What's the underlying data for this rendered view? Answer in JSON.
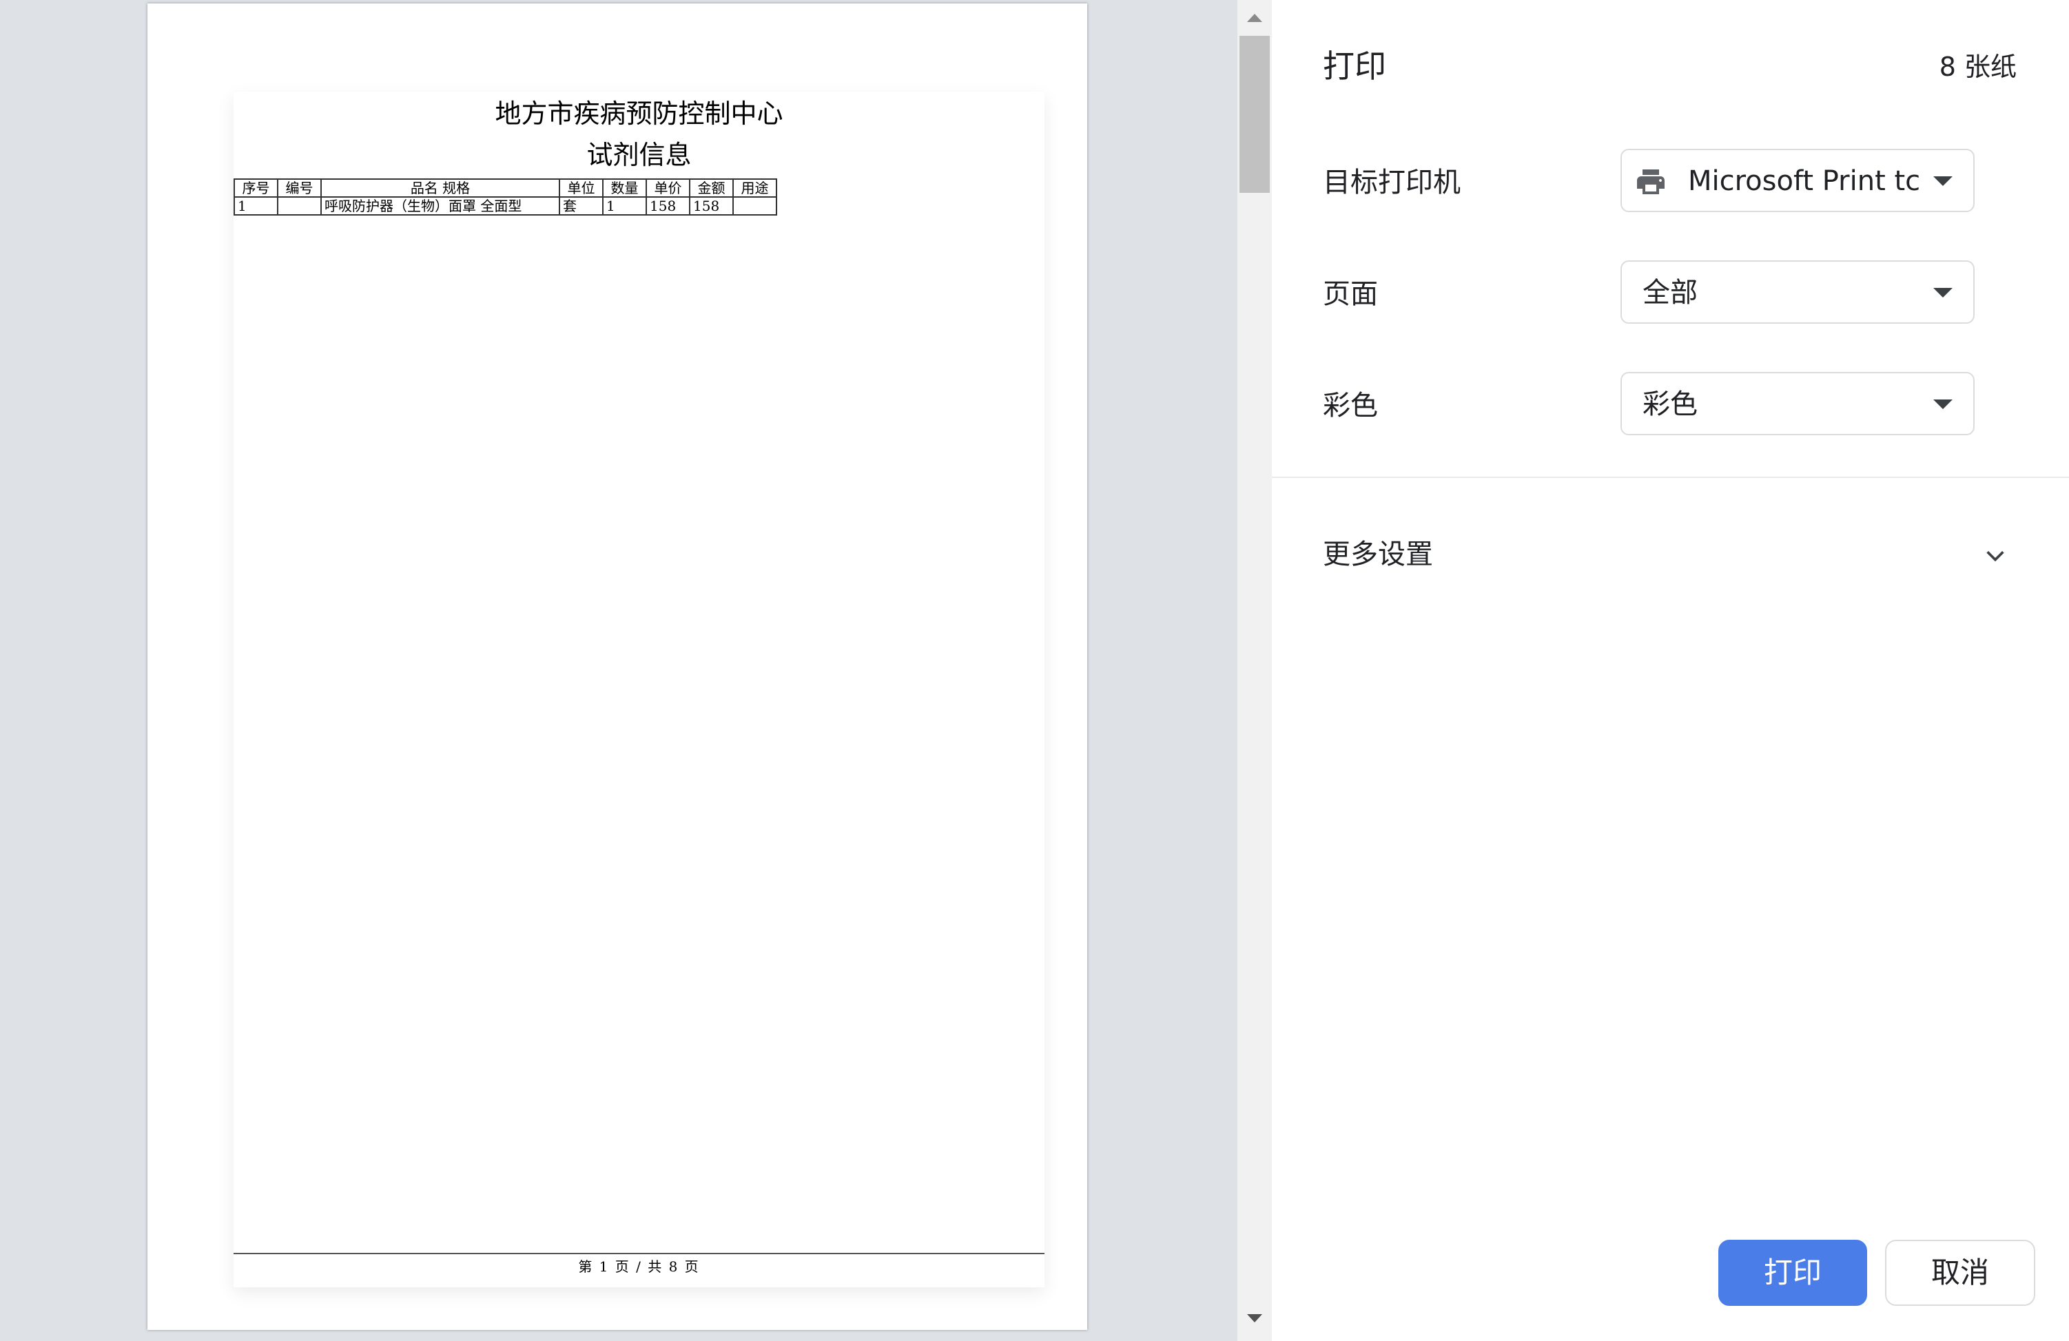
{
  "preview": {
    "document": {
      "title": "地方市疾病预防控制中心",
      "subtitle": "试剂信息",
      "table": {
        "headers": [
          "序号",
          "编号",
          "品名 规格",
          "单位",
          "数量",
          "单价",
          "金额",
          "用途"
        ],
        "rows": [
          [
            "1",
            "",
            "呼吸防护器（生物）面罩 全面型",
            "套",
            "1",
            "158",
            "158",
            ""
          ]
        ]
      },
      "footer": "第 1 页 / 共 8 页"
    }
  },
  "panel": {
    "title": "打印",
    "sheet_count": "8 张纸",
    "settings": [
      {
        "label": "目标打印机",
        "value": "Microsoft Print tc",
        "icon": "printer-icon"
      },
      {
        "label": "页面",
        "value": "全部"
      },
      {
        "label": "彩色",
        "value": "彩色"
      }
    ],
    "more_settings": "更多设置",
    "print_label": "打印",
    "cancel_label": "取消"
  },
  "colors": {
    "accent": "#4a7de8",
    "preview_background": "#dee1e6",
    "text": "#202124"
  }
}
